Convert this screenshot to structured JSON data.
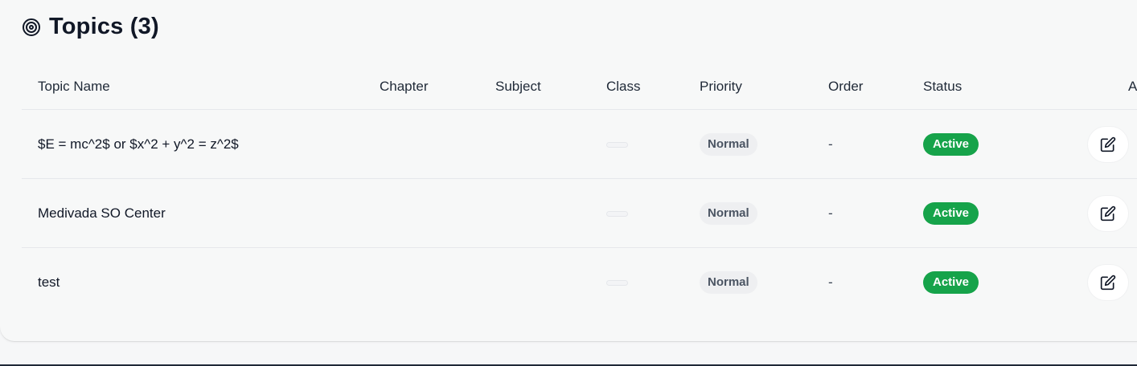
{
  "section": {
    "icon": "target-icon",
    "title": "Topics (3)"
  },
  "table": {
    "headers": {
      "topic_name": "Topic Name",
      "chapter": "Chapter",
      "subject": "Subject",
      "class": "Class",
      "priority": "Priority",
      "order": "Order",
      "status": "Status",
      "actions": "A"
    },
    "rows": [
      {
        "topic_name": "$E = mc^2$ or $x^2 + y^2 = z^2$",
        "chapter": "",
        "subject": "",
        "class": "",
        "priority": "Normal",
        "order": "-",
        "status": "Active",
        "action_icon": "edit-icon"
      },
      {
        "topic_name": "Medivada SO Center",
        "chapter": "",
        "subject": "",
        "class": "",
        "priority": "Normal",
        "order": "-",
        "status": "Active",
        "action_icon": "edit-icon"
      },
      {
        "topic_name": "test",
        "chapter": "",
        "subject": "",
        "class": "",
        "priority": "Normal",
        "order": "-",
        "status": "Active",
        "action_icon": "edit-icon"
      }
    ]
  },
  "colors": {
    "status_active_bg": "#16a34a",
    "priority_bg": "#eeeff1",
    "page_bg": "#f6f7f8"
  }
}
